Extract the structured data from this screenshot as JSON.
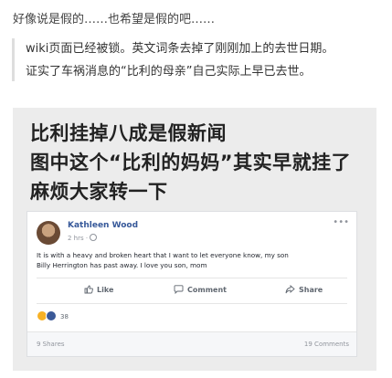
{
  "article": {
    "top_line": "好像说是假的……也希望是假的吧……",
    "quote_line1": "wiki页面已经被锁。英文词条去掉了刚刚加上的去世日期。",
    "quote_line2": "证实了车祸消息的“比利的母亲”自己实际上早已去世。"
  },
  "image": {
    "headline_line1": "比利挂掉八成是假新闻",
    "headline_line2": "图中这个“比利的妈妈”其实早就挂了",
    "headline_line3": "麻烦大家转一下",
    "post": {
      "poster_name": "Kathleen Wood",
      "time": "2 hrs ·",
      "text_line1": "It is with a heavy and broken heart that I want to let everyone know, my son",
      "text_line2": "Billy Herrington has past away. I love you son, mom",
      "like_label": "Like",
      "comment_label": "Comment",
      "share_label": "Share",
      "reaction_count": "38",
      "shares_label": "9 Shares",
      "comments_label": "19 Comments",
      "more_icon": "•••"
    }
  }
}
